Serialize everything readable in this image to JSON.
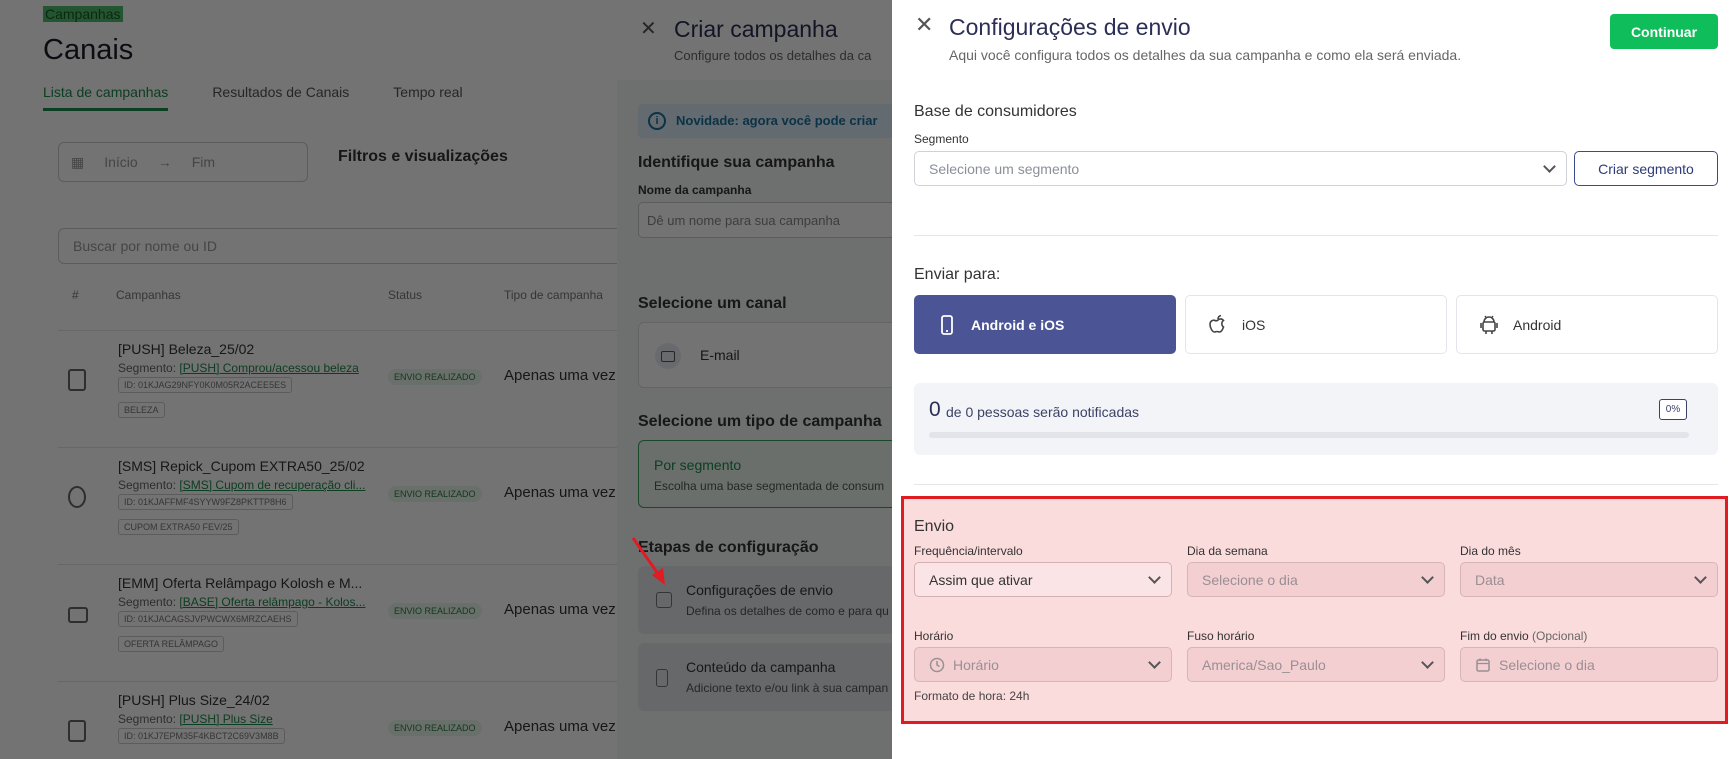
{
  "background": {
    "breadcrumb": "Campanhas",
    "title": "Canais",
    "tabs": [
      "Lista de campanhas",
      "Resultados de Canais",
      "Tempo real"
    ],
    "filter": {
      "start": "Início",
      "separator": "→",
      "end": "Fim"
    },
    "filters_title": "Filtros e visualizações",
    "search_placeholder": "Buscar por nome ou ID",
    "table_headers": [
      "#",
      "Campanhas",
      "Status",
      "Tipo de campanha"
    ],
    "rows": [
      {
        "name": "[PUSH] Beleza_25/02",
        "segment_label": "Segmento:",
        "segment": "[PUSH] Comprou/acessou beleza",
        "id": "ID: 01KJAG29NFY0K0M05R2ACEE5ES",
        "tag": "BELEZA",
        "status": "ENVIO REALIZADO",
        "type": "Apenas uma vez"
      },
      {
        "name": "[SMS] Repick_Cupom EXTRA50_25/02",
        "segment_label": "Segmento:",
        "segment": "[SMS] Cupom de recuperação cli...",
        "id": "ID: 01KJAFFMF4SYYW9FZ8PKTTP8H6",
        "tag": "CUPOM EXTRA50 FEV/25",
        "status": "ENVIO REALIZADO",
        "type": "Apenas uma vez"
      },
      {
        "name": "[EMM] Oferta Relâmpago Kolosh e M...",
        "segment_label": "Segmento:",
        "segment": "[BASE] Oferta relâmpago - Kolos...",
        "id": "ID: 01KJACAGSJVPWCWX6MRZCAEHS",
        "tag": "OFERTA RELÂMPAGO",
        "status": "ENVIO REALIZADO",
        "type": "Apenas uma vez"
      },
      {
        "name": "[PUSH] Plus Size_24/02",
        "segment_label": "Segmento:",
        "segment": "[PUSH] Plus Size",
        "id": "ID: 01KJ7EPM35F4KBCT2C69V3M8B",
        "tag": "",
        "status": "ENVIO REALIZADO",
        "type": "Apenas uma vez"
      }
    ]
  },
  "middle": {
    "title": "Criar campanha",
    "subtitle": "Configure todos os detalhes da ca",
    "news": "Novidade: agora você pode criar",
    "identify_title": "Identifique sua campanha",
    "name_label": "Nome da campanha",
    "name_placeholder": "Dê um nome para sua campanha",
    "channel_title": "Selecione um canal",
    "channel_email": "E-mail",
    "type_title": "Selecione um tipo de campanha",
    "type_segment_title": "Por segmento",
    "type_segment_desc": "Escolha uma base segmentada de consum",
    "steps_title": "Etapas de configuração",
    "steps": [
      {
        "title": "Configurações de envio",
        "desc": "Defina os detalhes de como e para qu"
      },
      {
        "title": "Conteúdo da campanha",
        "desc": "Adicione texto e/ou link à sua campan"
      }
    ]
  },
  "panel": {
    "title": "Configurações de envio",
    "subtitle": "Aqui você configura todos os detalhes da sua campanha e como ela será enviada.",
    "continue_label": "Continuar",
    "base_title": "Base de consumidores",
    "segment_label": "Segmento",
    "segment_placeholder": "Selecione um segmento",
    "create_segment_label": "Criar segmento",
    "send_to_title": "Enviar para:",
    "platforms": [
      {
        "label": "Android e iOS",
        "icon": "phone-icon",
        "active": true
      },
      {
        "label": "iOS",
        "icon": "apple-icon",
        "active": false
      },
      {
        "label": "Android",
        "icon": "android-icon",
        "active": false
      }
    ],
    "reach": {
      "count": "0",
      "text": "de 0 pessoas serão notificadas",
      "percent_label": "0%",
      "percent": 0
    },
    "envio": {
      "title": "Envio",
      "frequency_label": "Frequência/intervalo",
      "frequency_value": "Assim que ativar",
      "weekday_label": "Dia da semana",
      "weekday_placeholder": "Selecione o dia",
      "monthday_label": "Dia do mês",
      "monthday_placeholder": "Data",
      "time_label": "Horário",
      "time_placeholder": "Horário",
      "timezone_label": "Fuso horário",
      "timezone_value": "America/Sao_Paulo",
      "end_label": "Fim do envio",
      "end_optional": "(Opcional)",
      "end_placeholder": "Selecione o dia",
      "time_hint": "Formato de hora: 24h"
    }
  }
}
